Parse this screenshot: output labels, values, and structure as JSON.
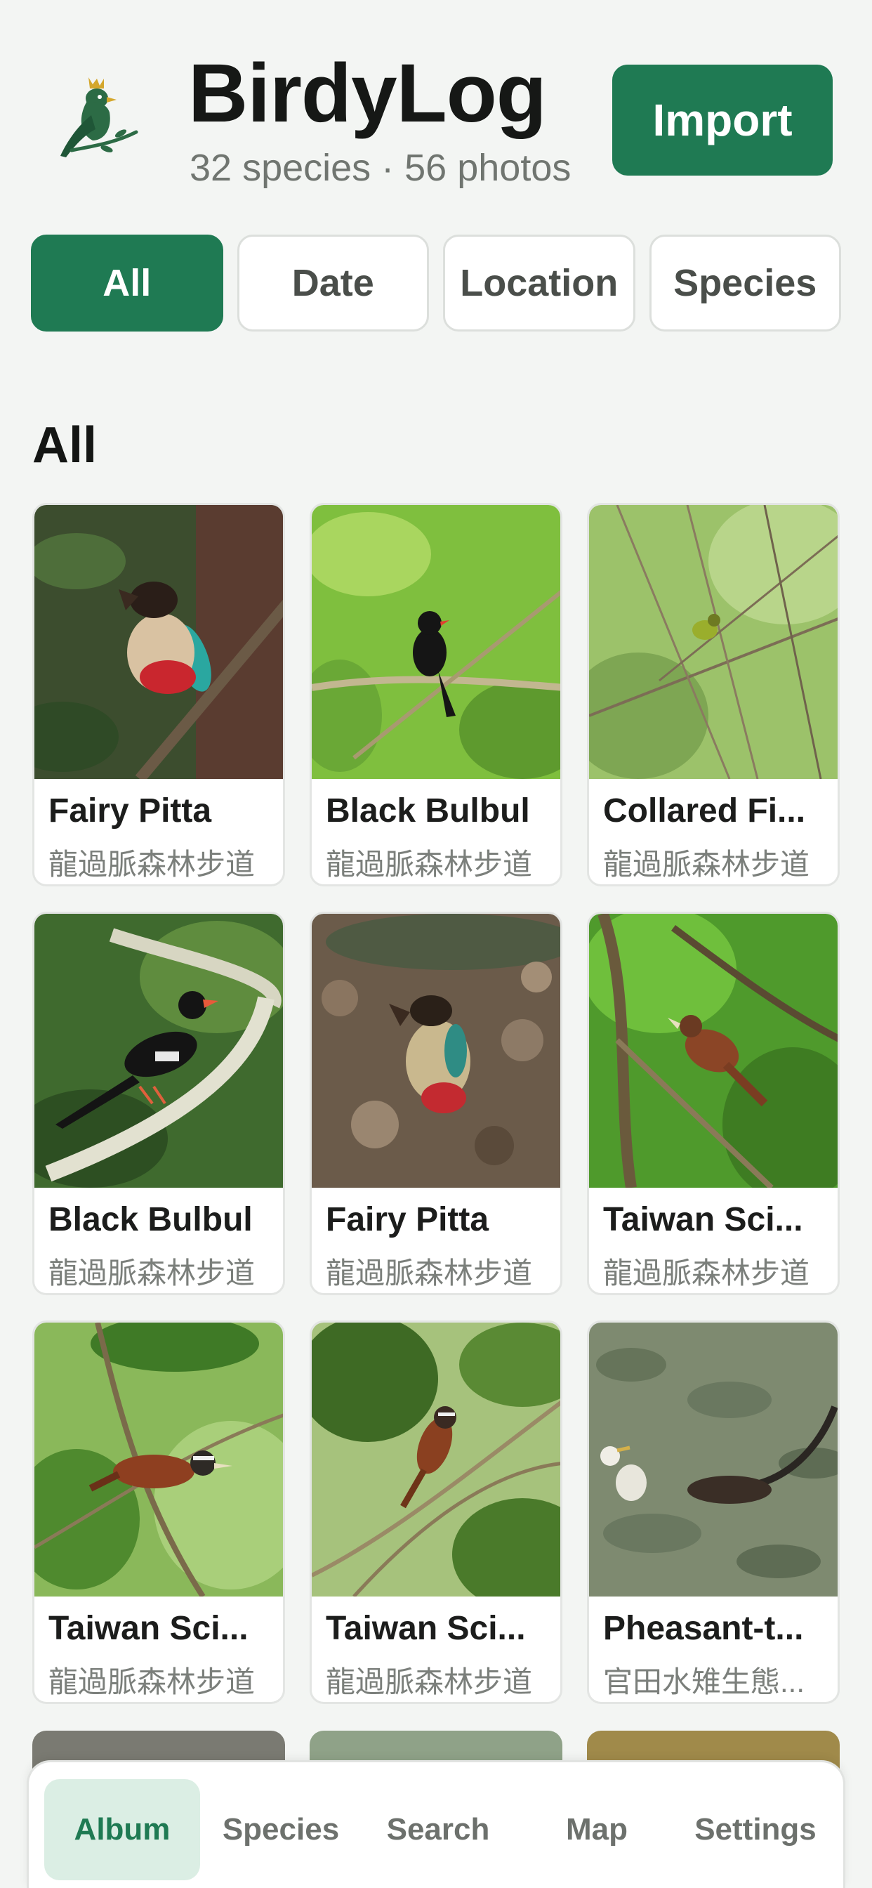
{
  "header": {
    "title": "BirdyLog",
    "subtitle": "32 species · 56 photos",
    "import_label": "Import",
    "logo_icon": "bird-with-crown-icon"
  },
  "filters": [
    {
      "label": "All",
      "active": true
    },
    {
      "label": "Date",
      "active": false
    },
    {
      "label": "Location",
      "active": false
    },
    {
      "label": "Species",
      "active": false
    }
  ],
  "section_title": "All",
  "photos": [
    {
      "name": "Fairy Pitta",
      "location": "龍過脈森林步道"
    },
    {
      "name": "Black Bulbul",
      "location": "龍過脈森林步道"
    },
    {
      "name": "Collared Fi...",
      "location": "龍過脈森林步道"
    },
    {
      "name": "Black Bulbul",
      "location": "龍過脈森林步道"
    },
    {
      "name": "Fairy Pitta",
      "location": "龍過脈森林步道"
    },
    {
      "name": "Taiwan Sci...",
      "location": "龍過脈森林步道"
    },
    {
      "name": "Taiwan Sci...",
      "location": "龍過脈森林步道"
    },
    {
      "name": "Taiwan Sci...",
      "location": "龍過脈森林步道"
    },
    {
      "name": "Pheasant-t...",
      "location": "官田水雉生態..."
    }
  ],
  "tabbar": [
    {
      "label": "Album",
      "active": true
    },
    {
      "label": "Species",
      "active": false
    },
    {
      "label": "Search",
      "active": false
    },
    {
      "label": "Map",
      "active": false
    },
    {
      "label": "Settings",
      "active": false
    }
  ],
  "colors": {
    "accent": "#1f7a53",
    "accent_light": "#dbeee4",
    "background": "#f3f5f3"
  }
}
